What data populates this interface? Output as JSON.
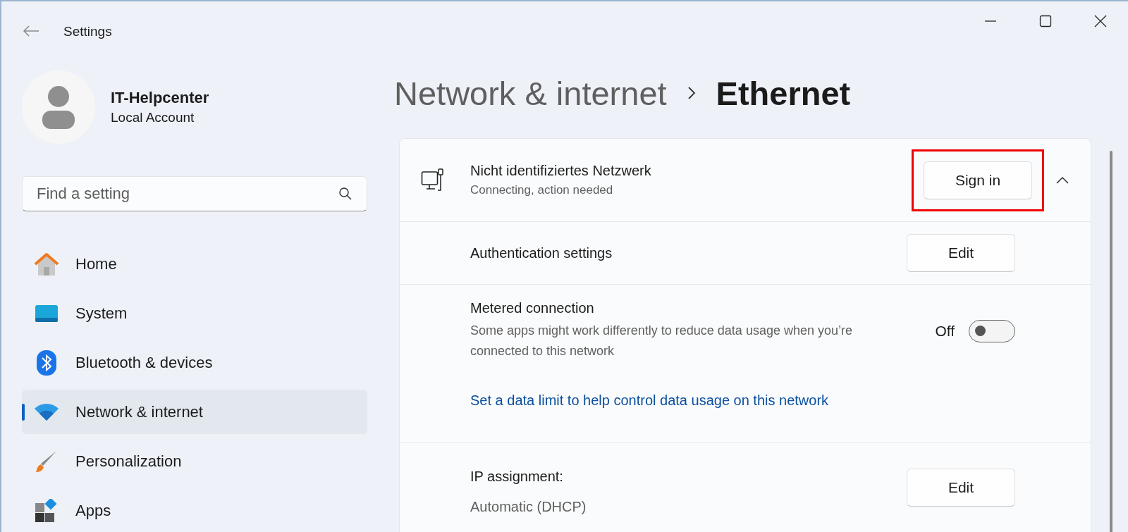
{
  "window": {
    "title": "Settings"
  },
  "account": {
    "name": "IT-Helpcenter",
    "type": "Local Account"
  },
  "search": {
    "placeholder": "Find a setting"
  },
  "nav": [
    {
      "label": "Home",
      "kind": "home",
      "selected": false
    },
    {
      "label": "System",
      "kind": "system",
      "selected": false
    },
    {
      "label": "Bluetooth & devices",
      "kind": "bluetooth",
      "selected": false
    },
    {
      "label": "Network & internet",
      "kind": "network",
      "selected": true
    },
    {
      "label": "Personalization",
      "kind": "brush",
      "selected": false
    },
    {
      "label": "Apps",
      "kind": "apps",
      "selected": false
    }
  ],
  "breadcrumb": {
    "parent": "Network & internet",
    "current": "Ethernet"
  },
  "network": {
    "name": "Nicht identifiziertes Netzwerk",
    "status": "Connecting, action needed",
    "button": "Sign in",
    "highlighted": true,
    "expanded": true
  },
  "rows": [
    {
      "kind": "button",
      "title": "Authentication settings",
      "button": "Edit"
    },
    {
      "kind": "toggle",
      "title": "Metered connection",
      "description": "Some apps might work differently to reduce data usage when you’re connected to this network",
      "state_label": "Off",
      "on": false,
      "link": "Set a data limit to help control data usage on this network"
    },
    {
      "kind": "button",
      "title": "IP assignment:",
      "value": "Automatic (DHCP)",
      "button": "Edit"
    }
  ]
}
